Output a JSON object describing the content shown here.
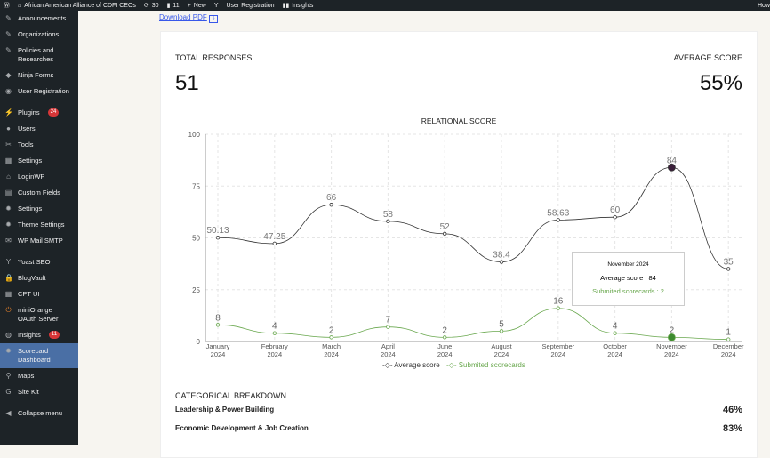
{
  "adminbar": {
    "site": "African American Alliance of CDFI CEOs",
    "updates": "30",
    "comments": "11",
    "new": "New",
    "user_reg": "User Registration",
    "insights": "Insights",
    "howdy": "How"
  },
  "sidebar": {
    "items": [
      {
        "label": "Announcements",
        "icon": "pin-icon"
      },
      {
        "label": "Organizations",
        "icon": "pin-icon"
      },
      {
        "label": "Policies and Researches",
        "icon": "pin-icon"
      },
      {
        "label": "Ninja Forms",
        "icon": "ninja-icon"
      },
      {
        "label": "User Registration",
        "icon": "ur-icon"
      },
      {
        "label": "Plugins",
        "icon": "plugin-icon",
        "badge": "24"
      },
      {
        "label": "Users",
        "icon": "user-icon"
      },
      {
        "label": "Tools",
        "icon": "wrench-icon"
      },
      {
        "label": "Settings",
        "icon": "settings-icon"
      },
      {
        "label": "LoginWP",
        "icon": "home-icon"
      },
      {
        "label": "Custom Fields",
        "icon": "table-icon"
      },
      {
        "label": "Settings",
        "icon": "gear-icon"
      },
      {
        "label": "Theme Settings",
        "icon": "gear-icon"
      },
      {
        "label": "WP Mail SMTP",
        "icon": "mail-icon"
      },
      {
        "label": "Yoast SEO",
        "icon": "yoast-icon"
      },
      {
        "label": "BlogVault",
        "icon": "lock-icon"
      },
      {
        "label": "CPT UI",
        "icon": "grid-icon"
      },
      {
        "label": "miniOrange OAuth Server",
        "icon": "power-icon"
      },
      {
        "label": "Insights",
        "icon": "insights-icon",
        "badge": "11"
      },
      {
        "label": "Scorecard Dashboard",
        "icon": "gear-icon",
        "active": true
      },
      {
        "label": "Maps",
        "icon": "map-pin-icon"
      },
      {
        "label": "Site Kit",
        "icon": "g-icon"
      },
      {
        "label": "Collapse menu",
        "icon": "collapse-icon"
      }
    ]
  },
  "download": "Download PDF",
  "stats": {
    "total_label": "TOTAL RESPONSES",
    "total": "51",
    "avg_label": "AVERAGE SCORE",
    "avg": "55%"
  },
  "chart_data": {
    "type": "line",
    "title": "RELATIONAL SCORE",
    "ylim": [
      0,
      100
    ],
    "yticks": [
      0,
      25,
      50,
      75,
      100
    ],
    "grid": true,
    "legend": "bottom",
    "categories": [
      [
        "January",
        "2024"
      ],
      [
        "February",
        "2024"
      ],
      [
        "March",
        "2024"
      ],
      [
        "April",
        "2024"
      ],
      [
        "June",
        "2024"
      ],
      [
        "August",
        "2024"
      ],
      [
        "September",
        "2024"
      ],
      [
        "October",
        "2024"
      ],
      [
        "November",
        "2024"
      ],
      [
        "December",
        "2024"
      ]
    ],
    "series": [
      {
        "name": "Average score",
        "color": "#333333",
        "values": [
          50.13,
          47.25,
          66,
          58,
          52,
          38.4,
          58.63,
          60,
          84,
          35
        ]
      },
      {
        "name": "Submited scorecards",
        "color": "#6aa84f",
        "values": [
          8,
          4,
          2,
          7,
          2,
          5,
          16,
          4,
          2,
          1
        ]
      }
    ]
  },
  "tooltip": {
    "title": "November 2024",
    "avg": "Average score : 84",
    "sub": "Submited scorecards : 2"
  },
  "breakdown": {
    "title": "CATEGORICAL BREAKDOWN",
    "rows": [
      {
        "label": "Leadership & Power Building",
        "value": "46%"
      },
      {
        "label": "Economic Development & Job Creation",
        "value": "83%"
      }
    ]
  }
}
